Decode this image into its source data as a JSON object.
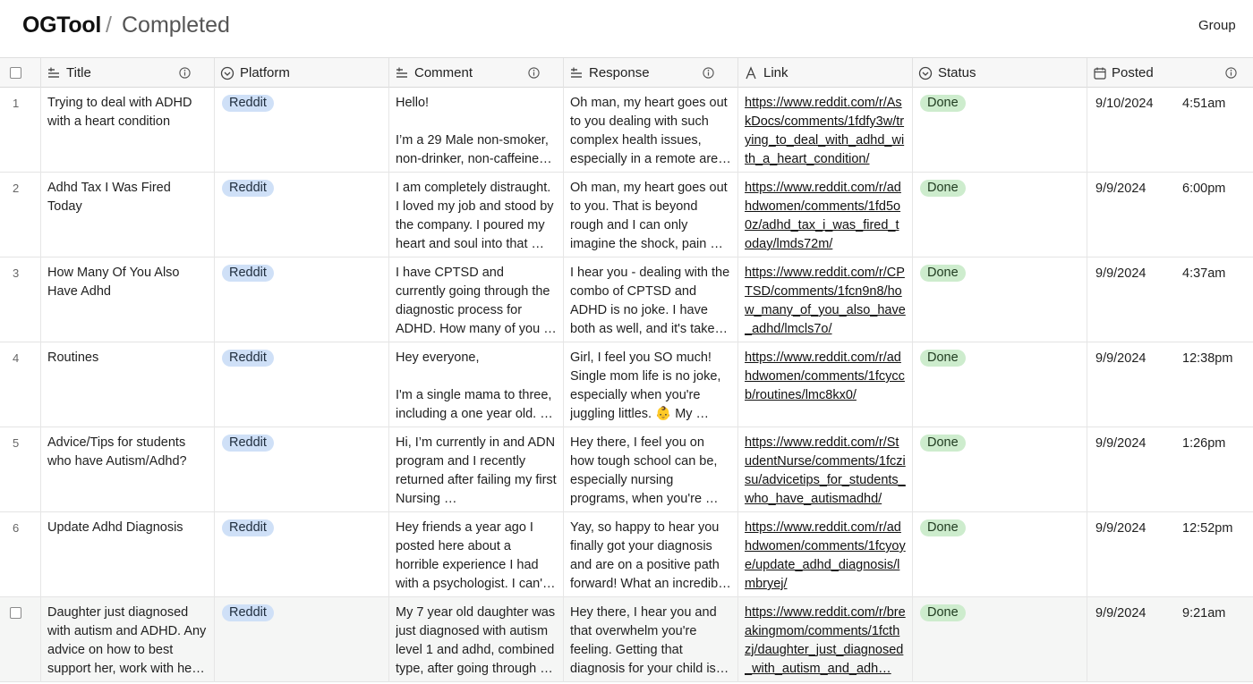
{
  "header": {
    "brand": "OGTool",
    "separator": "/",
    "breadcrumb": "Completed",
    "group_label": "Group"
  },
  "columns": {
    "title": "Title",
    "platform": "Platform",
    "comment": "Comment",
    "response": "Response",
    "link": "Link",
    "status": "Status",
    "posted": "Posted"
  },
  "rows": [
    {
      "num": "1",
      "title": "Trying to deal with ADHD with a heart condition",
      "platform": "Reddit",
      "comment": "Hello!\n\nI’m a 29 Male non-smoker, non-drinker, non-caffeine…",
      "response": "Oh man, my heart goes out to you dealing with such complex health issues, especially in a remote are…",
      "link": "https://www.reddit.com/r/AskDocs/comments/1fdfy3w/trying_to_deal_with_adhd_with_a_heart_condition/",
      "status": "Done",
      "date": "9/10/2024",
      "time": "4:51am"
    },
    {
      "num": "2",
      "title": "Adhd Tax I Was Fired Today",
      "platform": "Reddit",
      "comment": "I am completely distraught. I loved my job and stood by the company. I poured my heart and soul into that …",
      "response": "Oh man, my heart goes out to you. That is beyond rough and I can only imagine the shock, pain …",
      "link": "https://www.reddit.com/r/adhdwomen/comments/1fd5o0z/adhd_tax_i_was_fired_today/lmds72m/",
      "status": "Done",
      "date": "9/9/2024",
      "time": "6:00pm"
    },
    {
      "num": "3",
      "title": "How Many Of You Also Have Adhd",
      "platform": "Reddit",
      "comment": "I have CPTSD and currently going through the diagnostic process for ADHD. How many of you …",
      "response": "I hear you - dealing with the combo of CPTSD and ADHD is no joke. I have both as well, and it's take…",
      "link": "https://www.reddit.com/r/CPTSD/comments/1fcn9n8/how_many_of_you_also_have_adhd/lmcls7o/",
      "status": "Done",
      "date": "9/9/2024",
      "time": "4:37am"
    },
    {
      "num": "4",
      "title": "Routines",
      "platform": "Reddit",
      "comment": "Hey everyone,\n\nI'm a single mama to three, including a one year old. …",
      "response": "Girl, I feel you SO much! Single mom life is no joke, especially when you're juggling littles. 👶 My …",
      "link": "https://www.reddit.com/r/adhdwomen/comments/1fcyccb/routines/lmc8kx0/",
      "status": "Done",
      "date": "9/9/2024",
      "time": "12:38pm"
    },
    {
      "num": "5",
      "title": "Advice/Tips for students who have Autism/Adhd?",
      "platform": "Reddit",
      "comment": "Hi, I’m currently in and ADN program and I recently returned after failing my first Nursing …",
      "response": "Hey there, I feel you on how tough school can be, especially nursing programs, when you're …",
      "link": "https://www.reddit.com/r/StudentNurse/comments/1fczisu/advicetips_for_students_who_have_autismadhd/",
      "status": "Done",
      "date": "9/9/2024",
      "time": "1:26pm"
    },
    {
      "num": "6",
      "title": "Update Adhd Diagnosis",
      "platform": "Reddit",
      "comment": "Hey friends a year ago I posted here about a horrible experience I had with a psychologist. I can' …",
      "response": "Yay, so happy to hear you finally got your diagnosis and are on a positive path forward! What an incredib…",
      "link": "https://www.reddit.com/r/adhdwomen/comments/1fcyoye/update_adhd_diagnosis/lmbryej/",
      "status": "Done",
      "date": "9/9/2024",
      "time": "12:52pm"
    },
    {
      "num": "",
      "title": "Daughter just diagnosed with autism and ADHD. Any advice on how to best support her, work with he…",
      "platform": "Reddit",
      "comment": "My 7 year old daughter was just diagnosed with autism level 1 and adhd, combined type, after going through …",
      "response": "Hey there, I hear you and that overwhelm you're feeling. Getting that diagnosis for your child is…",
      "link": "https://www.reddit.com/r/breakingmom/comments/1fcthzj/daughter_just_diagnosed_with_autism_and_adh…",
      "status": "Done",
      "date": "9/9/2024",
      "time": "9:21am"
    }
  ]
}
